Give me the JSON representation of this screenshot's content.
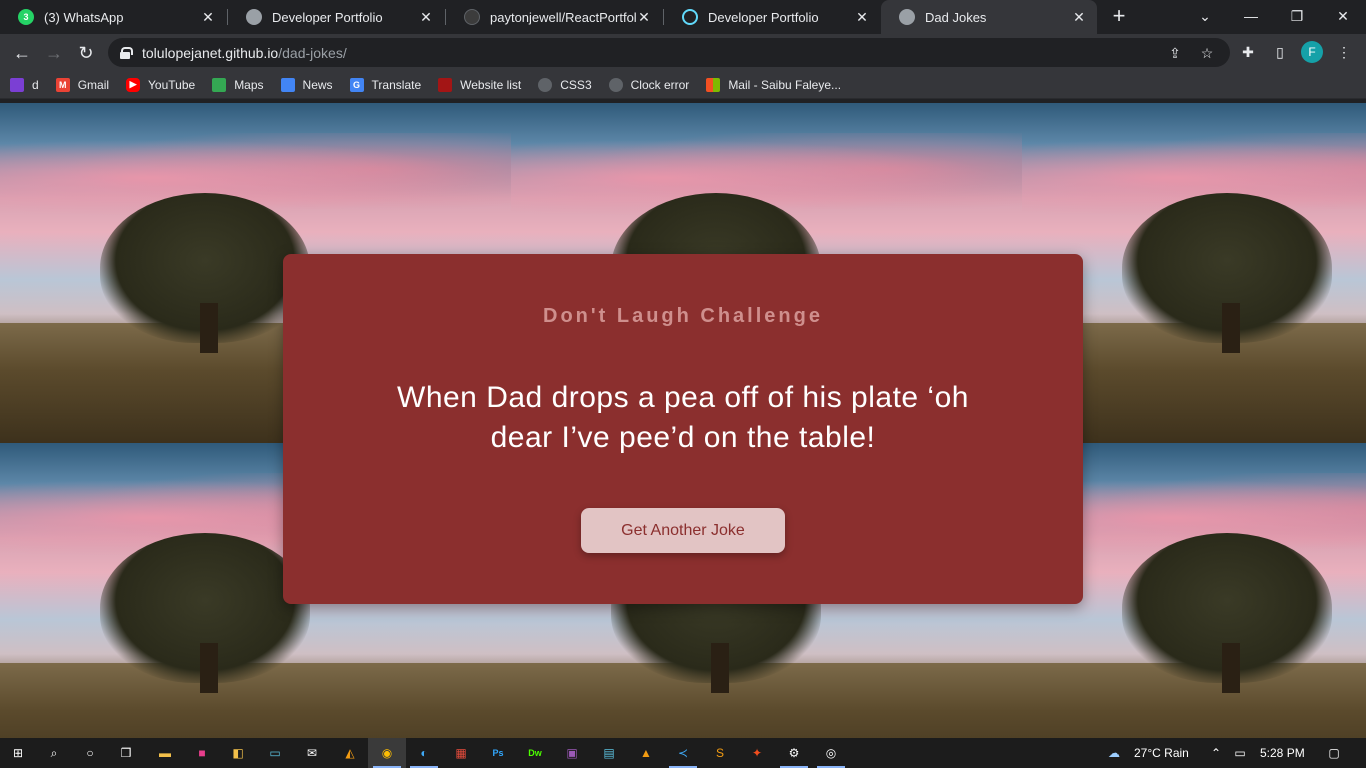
{
  "tabs": [
    {
      "title": "(3) WhatsApp",
      "icon": "whatsapp-icon",
      "color": "#25d366"
    },
    {
      "title": "Developer Portfolio",
      "icon": "globe-icon",
      "color": "#9aa0a6"
    },
    {
      "title": "paytonjewell/ReactPortfolioTe",
      "icon": "github-icon",
      "color": "#3c3c3c"
    },
    {
      "title": "Developer Portfolio",
      "icon": "react-icon",
      "color": "#61dafb"
    },
    {
      "title": "Dad Jokes",
      "icon": "globe-icon",
      "color": "#9aa0a6",
      "active": true
    }
  ],
  "window": {
    "minimize": "—",
    "restore": "❐",
    "close": "✕",
    "tab_search": "⌄",
    "new_tab": "+"
  },
  "address": {
    "host": "tolulopejanet.github.io",
    "path": "/dad-jokes/"
  },
  "profile": {
    "initial": "F",
    "color": "#15a1a8"
  },
  "bookmarks": [
    {
      "label": "d",
      "icon": "bookmark-icon",
      "color": "#7b3fd4"
    },
    {
      "label": "Gmail",
      "icon": "gmail-icon",
      "color": "#ea4335"
    },
    {
      "label": "YouTube",
      "icon": "youtube-icon",
      "color": "#ff0000"
    },
    {
      "label": "Maps",
      "icon": "maps-icon",
      "color": "#34a853"
    },
    {
      "label": "News",
      "icon": "news-icon",
      "color": "#4285f4"
    },
    {
      "label": "Translate",
      "icon": "translate-icon",
      "color": "#4285f4"
    },
    {
      "label": "Website list",
      "icon": "website-list-icon",
      "color": "#a31515"
    },
    {
      "label": "CSS3",
      "icon": "globe-icon",
      "color": "#5f6368"
    },
    {
      "label": "Clock error",
      "icon": "globe-icon",
      "color": "#5f6368"
    },
    {
      "label": "Mail - Saibu Faleye...",
      "icon": "microsoft-icon",
      "color": "#f25022"
    }
  ],
  "page": {
    "heading": "Don't Laugh Challenge",
    "joke": "When Dad drops a pea off of his plate ‘oh dear I’ve pee’d on the table!",
    "button": "Get Another Joke"
  },
  "taskbar": {
    "weather": "27°C  Rain",
    "time": "5:28 PM"
  },
  "colors": {
    "card": "#8b2f2e",
    "heading": "#cf8f8d",
    "button_bg": "#e2c4c4"
  }
}
